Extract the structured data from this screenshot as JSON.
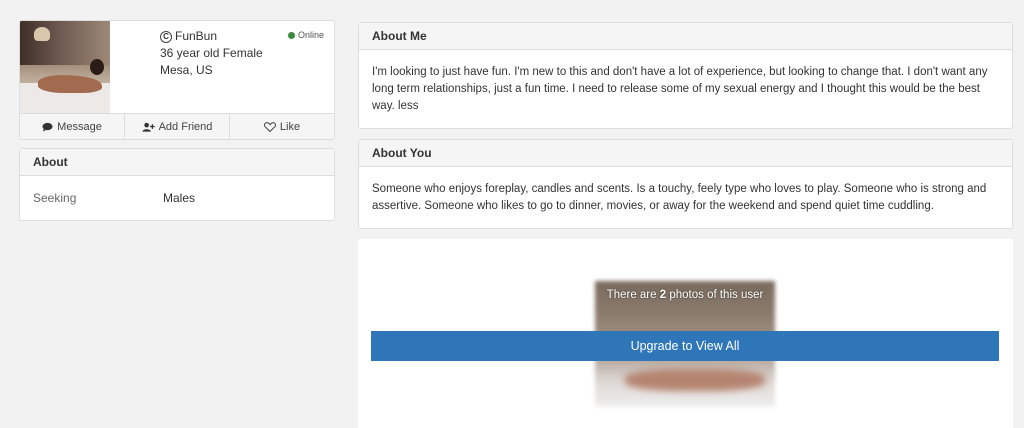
{
  "profile": {
    "username": "FunBun",
    "age_gender": "36 year old Female",
    "location": "Mesa, US",
    "status": "Online",
    "status_color": "#3c8a3c"
  },
  "actions": {
    "message": "Message",
    "add_friend": "Add Friend",
    "like": "Like"
  },
  "about_left": {
    "title": "About",
    "seeking_label": "Seeking",
    "seeking_value": "Males"
  },
  "about_me": {
    "title": "About Me",
    "text": "I'm looking to just have fun. I'm new to this and don't have a lot of experience, but looking to change that. I don't want any long term relationships, just a fun time. I need to release some of my sexual energy and I thought this would be the best way. less"
  },
  "about_you": {
    "title": "About You",
    "text": "Someone who enjoys foreplay, candles and scents. Is a touchy, feely type who loves to play. Someone who is strong and assertive. Someone who likes to go to dinner, movies, or away for the weekend and spend quiet time cuddling."
  },
  "photos": {
    "prefix": "There are",
    "count": "2",
    "suffix": "photos of this user",
    "upgrade_label": "Upgrade to View All",
    "button_color": "#2e76b8"
  }
}
